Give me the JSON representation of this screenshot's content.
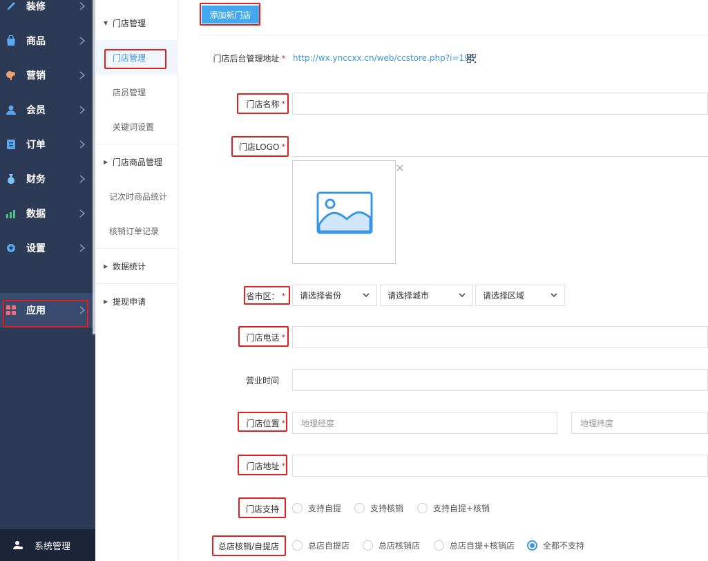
{
  "sidebar": {
    "items": [
      {
        "label": "装修",
        "icon": "brush-icon"
      },
      {
        "label": "商品",
        "icon": "shopping-bag-icon"
      },
      {
        "label": "营销",
        "icon": "marketing-icon"
      },
      {
        "label": "会员",
        "icon": "member-icon"
      },
      {
        "label": "订单",
        "icon": "order-icon"
      },
      {
        "label": "财务",
        "icon": "money-bag-icon"
      },
      {
        "label": "数据",
        "icon": "chart-icon"
      },
      {
        "label": "设置",
        "icon": "gear-icon"
      },
      {
        "label": "应用",
        "icon": "apps-icon"
      }
    ],
    "system": "系统管理"
  },
  "subnav": {
    "group1": "门店管理",
    "store_manage": "门店管理",
    "staff_manage": "店员管理",
    "keyword_settings": "关键词设置",
    "group2": "门店商品管理",
    "timed_stats": "记次时商品统计",
    "verify_records": "核销订单记录",
    "group3": "数据统计",
    "group4": "提现申请"
  },
  "form": {
    "add_button": "添加新门店",
    "backend_label": "门店后台管理地址",
    "backend_url": "http://wx.ynccxx.cn/web/ccstore.php?i=196",
    "name_label": "门店名称",
    "logo_label": "门店LOGO",
    "region_label": "省市区：",
    "province_placeholder": "请选择省份",
    "city_placeholder": "请选择城市",
    "district_placeholder": "请选择区域",
    "phone_label": "门店电话",
    "hours_label": "营业时间",
    "location_label": "门店位置",
    "longitude_placeholder": "地理经度",
    "latitude_placeholder": "地理纬度",
    "address_label": "门店地址",
    "support_label": "门店支持",
    "support_options": [
      "支持自提",
      "支持核销",
      "支持自提+核销"
    ],
    "hq_label": "总店核销/自提店",
    "hq_options": [
      "总店自提店",
      "总店核销店",
      "总店自提+核销店",
      "全都不支持"
    ],
    "hq_selected": "全都不支持",
    "required_mark": "*"
  }
}
